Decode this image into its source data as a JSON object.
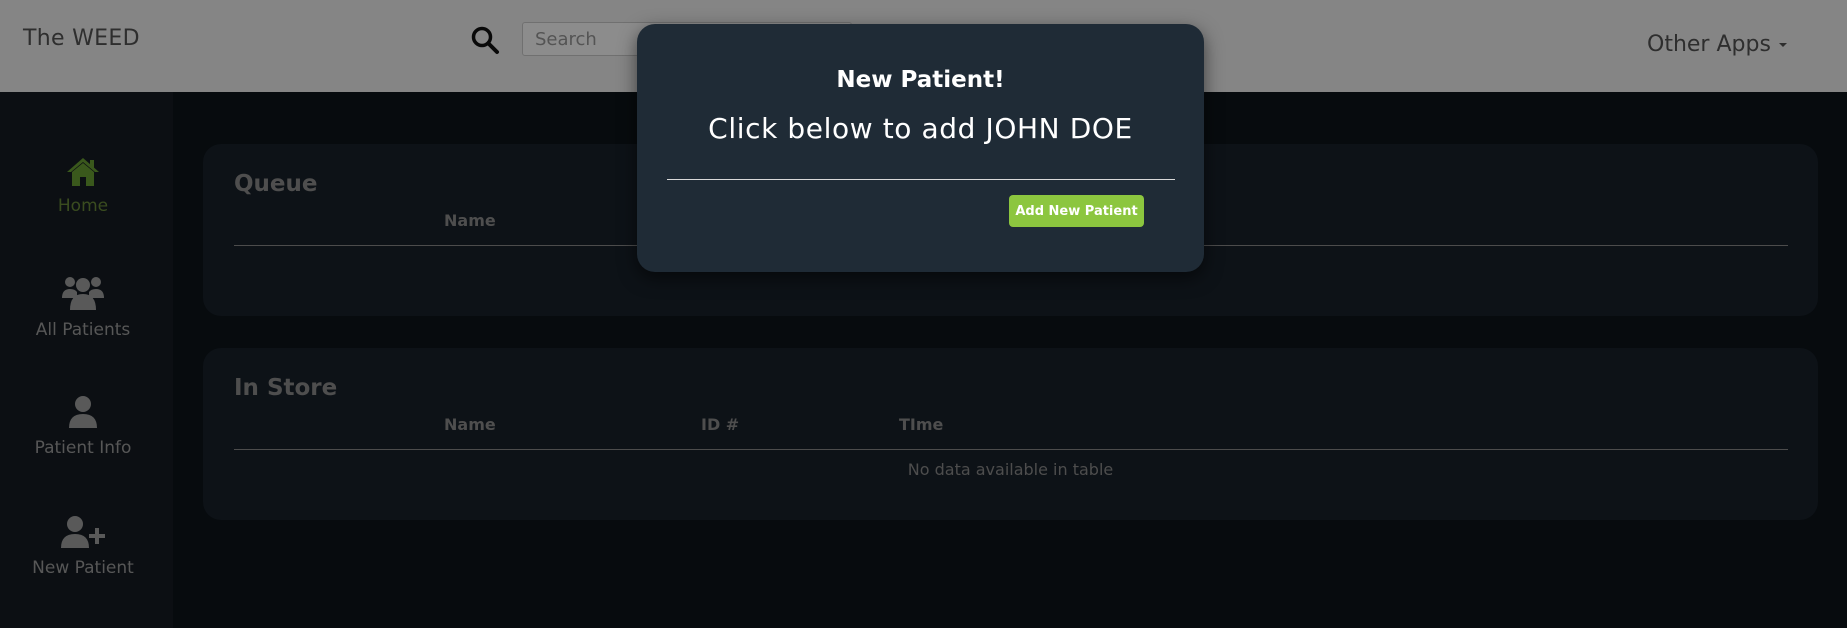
{
  "header": {
    "brand": "The WEED",
    "search_icon": "search-icon",
    "search_placeholder": "Search",
    "other_apps_label": "Other Apps"
  },
  "sidebar": {
    "items": [
      {
        "label": "Home",
        "icon": "home-icon",
        "active": true
      },
      {
        "label": "All Patients",
        "icon": "users-icon",
        "active": false
      },
      {
        "label": "Patient Info",
        "icon": "user-icon",
        "active": false
      },
      {
        "label": "New Patient",
        "icon": "user-plus-icon",
        "active": false
      }
    ]
  },
  "queue": {
    "title": "Queue",
    "columns": [
      "Name"
    ]
  },
  "in_store": {
    "title": "In Store",
    "columns": [
      "Name",
      "ID #",
      "TIme"
    ],
    "empty_message": "No data available in table"
  },
  "modal": {
    "title": "New Patient!",
    "body": "Click below to add JOHN DOE",
    "button_label": "Add New Patient"
  },
  "colors": {
    "accent_green": "#8cc63f",
    "active_nav": "#6a8b3a",
    "panel": "#18212a",
    "modal": "#1f2b36"
  }
}
